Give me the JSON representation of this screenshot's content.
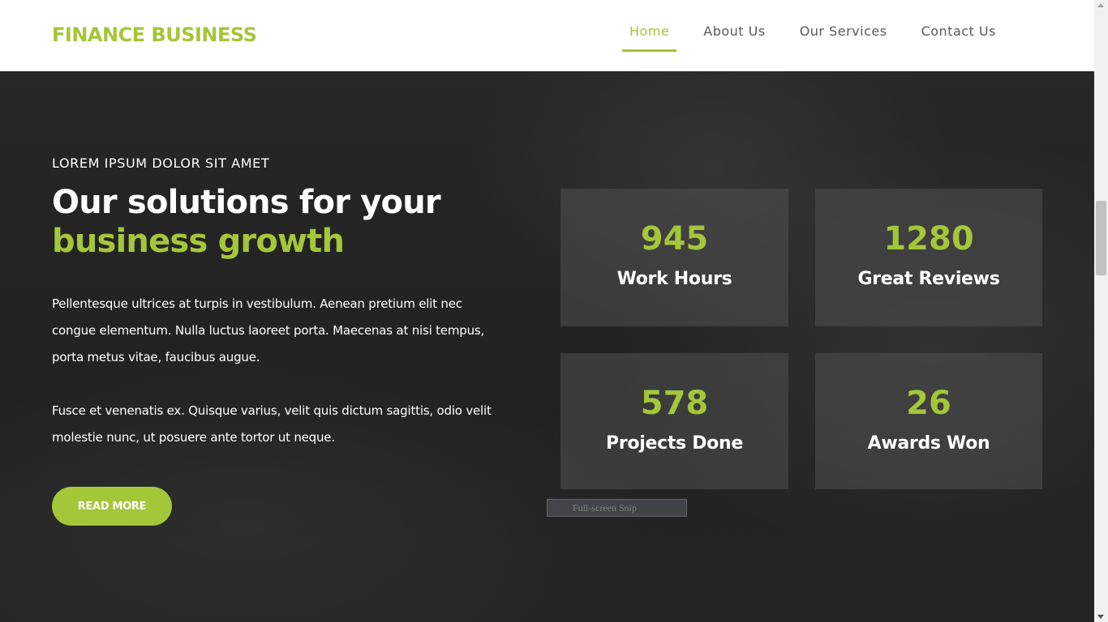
{
  "colors": {
    "accent": "#a4c639"
  },
  "header": {
    "logo": "FINANCE BUSINESS",
    "nav": [
      {
        "label": "Home",
        "active": true
      },
      {
        "label": "About Us",
        "active": false
      },
      {
        "label": "Our Services",
        "active": false
      },
      {
        "label": "Contact Us",
        "active": false
      }
    ]
  },
  "hero": {
    "kicker": "LOREM IPSUM DOLOR SIT AMET",
    "headline_line1": "Our solutions for your",
    "headline_line2": "business growth",
    "paragraph1": "Pellentesque ultrices at turpis in vestibulum. Aenean pretium elit nec congue elementum. Nulla luctus laoreet porta. Maecenas at nisi tempus, porta metus vitae, faucibus augue.",
    "paragraph2": "Fusce et venenatis ex. Quisque varius, velit quis dictum sagittis, odio velit molestie nunc, ut posuere ante tortor ut neque.",
    "button_label": "READ MORE"
  },
  "stats": [
    {
      "value": "945",
      "label": "Work Hours"
    },
    {
      "value": "1280",
      "label": "Great Reviews"
    },
    {
      "value": "578",
      "label": "Projects Done"
    },
    {
      "value": "26",
      "label": "Awards Won"
    }
  ],
  "overlay": {
    "snip_text": "Full-screen Snip"
  }
}
